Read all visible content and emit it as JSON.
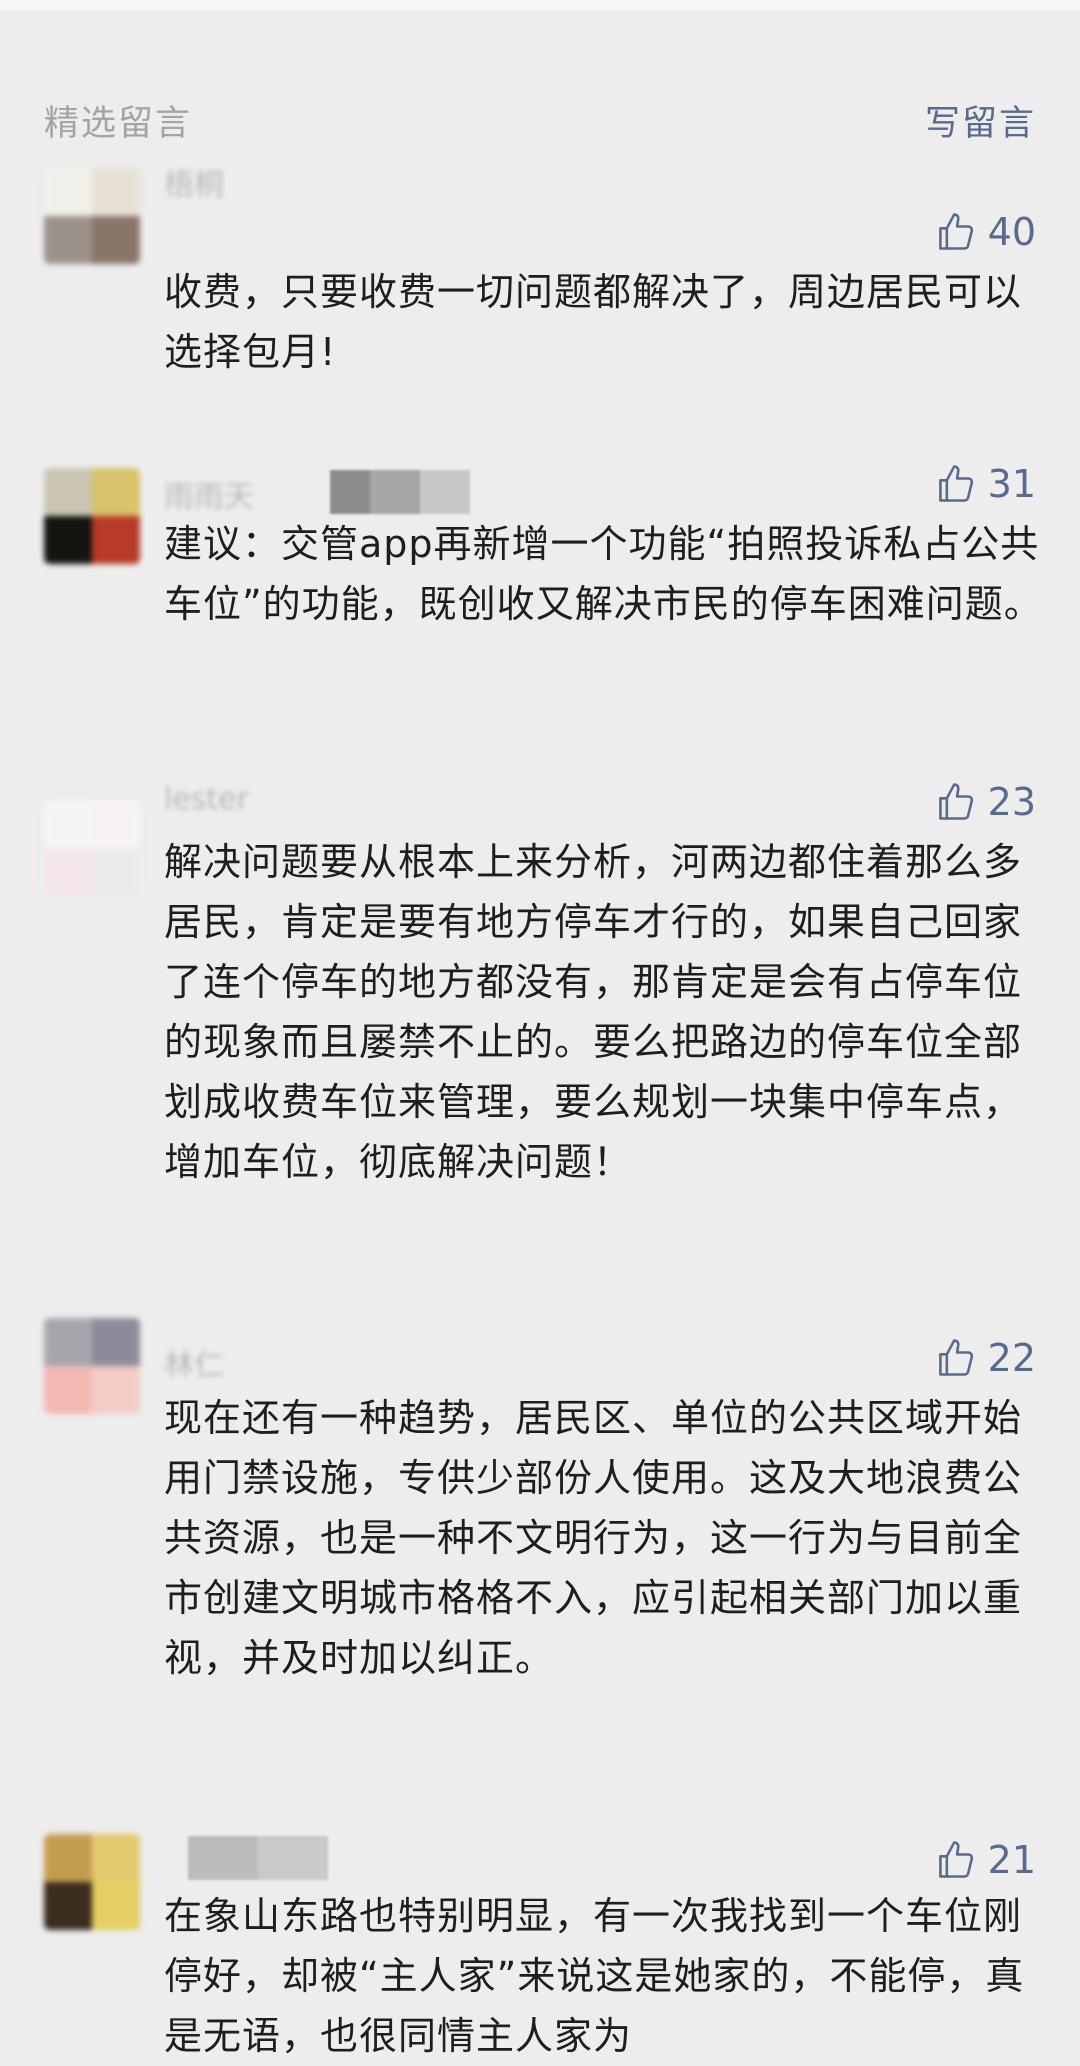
{
  "header": {
    "title": "精选留言",
    "write_label": "写留言"
  },
  "comments": [
    {
      "name": "梧桐",
      "likes": "40",
      "text": "收费，只要收费一切问题都解决了，周边居民可以选择包月!"
    },
    {
      "name": "雨雨天",
      "likes": "31",
      "text": "建议：交管app再新增一个功能“拍照投诉私占公共车位”的功能，既创收又解决市民的停车困难问题。"
    },
    {
      "name": "lester",
      "likes": "23",
      "text": "解决问题要从根本上来分析，河两边都住着那么多居民，肯定是要有地方停车才行的，如果自己回家了连个停车的地方都没有，那肯定是会有占停车位的现象而且屡禁不止的。要么把路边的停车位全部划成收费车位来管理，要么规划一块集中停车点，增加车位，彻底解决问题！"
    },
    {
      "name": "林仁",
      "likes": "22",
      "text": "现在还有一种趋势，居民区、单位的公共区域开始用门禁设施，专供少部份人使用。这及大地浪费公共资源，也是一种不文明行为，这一行为与目前全市创建文明城市格格不入，应引起相关部门加以重视，并及时加以纠正。"
    },
    {
      "name": "",
      "likes": "21",
      "text": "在象山东路也特别明显，有一次我找到一个车位刚停好，却被“主人家”来说这是她家的，不能停，真是无语，也很同情主人家为"
    }
  ],
  "colors": {
    "background": "#ededed",
    "header_gray": "#a4a4a4",
    "link_blue": "#596a8f",
    "body_text": "#1e1e1e"
  },
  "icons": {
    "like": "thumbs-up-icon"
  }
}
